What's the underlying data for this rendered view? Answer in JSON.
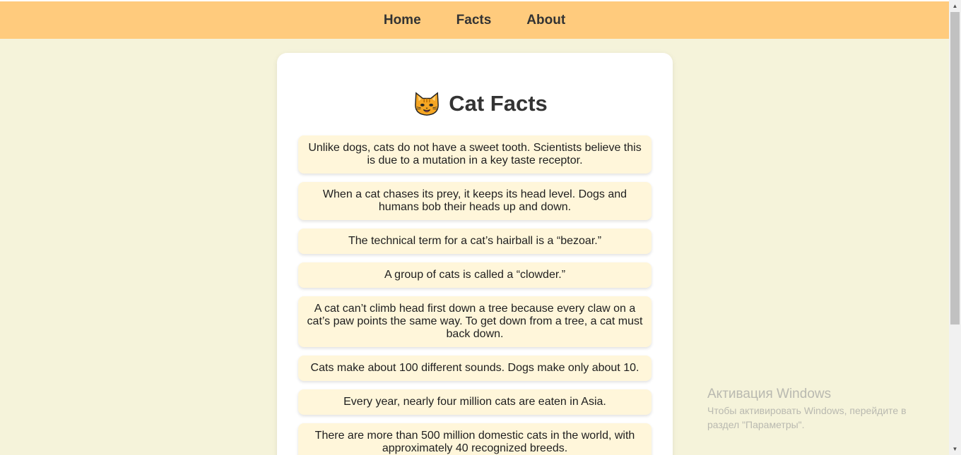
{
  "nav": {
    "items": [
      {
        "label": "Home"
      },
      {
        "label": "Facts"
      },
      {
        "label": "About"
      }
    ]
  },
  "main": {
    "title": "Cat Facts",
    "title_icon": "cat-face-icon",
    "facts": [
      "Unlike dogs, cats do not have a sweet tooth. Scientists believe this is due to a mutation in a key taste receptor.",
      "When a cat chases its prey, it keeps its head level. Dogs and humans bob their heads up and down.",
      "The technical term for a cat’s hairball is a “bezoar.”",
      "A group of cats is called a “clowder.”",
      "A cat can’t climb head first down a tree because every claw on a cat’s paw points the same way. To get down from a tree, a cat must back down.",
      "Cats make about 100 different sounds. Dogs make only about 10.",
      "Every year, nearly four million cats are eaten in Asia.",
      "There are more than 500 million domestic cats in the world, with approximately 40 recognized breeds."
    ]
  },
  "watermark": {
    "title": "Активация Windows",
    "subtitle": "Чтобы активировать Windows, перейдите в раздел \"Параметры\"."
  },
  "colors": {
    "nav_bg": "#ffcb7d",
    "page_bg": "#f5f3da",
    "fact_bg": "#fff6da"
  }
}
